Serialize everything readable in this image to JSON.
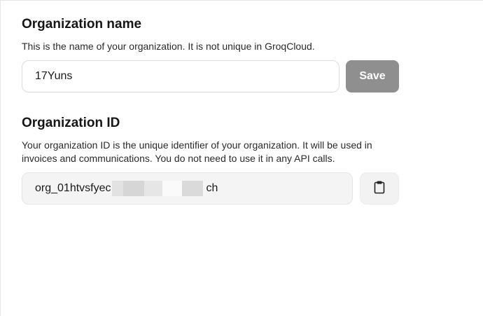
{
  "org_name_section": {
    "title": "Organization name",
    "description": "This is the name of your organization. It is not unique in GroqCloud.",
    "input_value": "17Yuns",
    "save_label": "Save"
  },
  "org_id_section": {
    "title": "Organization ID",
    "description": "Your organization ID is the unique identifier of your organization. It will be used in invoices and communications. You do not need to use it in any API calls.",
    "id_prefix": "org_01htvsfyec",
    "id_suffix": "ch",
    "copy_icon": "clipboard-icon"
  },
  "colors": {
    "save_button_bg": "#8f8f8f",
    "readonly_field_bg": "#f4f4f4",
    "input_border": "#dcdcdc"
  }
}
